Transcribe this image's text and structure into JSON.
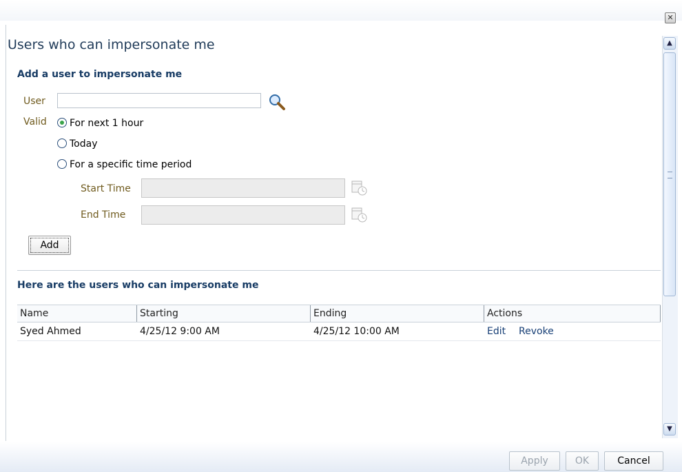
{
  "dialog": {
    "close_glyph": "✕"
  },
  "page_title": "Users who can impersonate me",
  "add_section": {
    "title": "Add a user to impersonate me",
    "user_label": "User",
    "user_value": "",
    "valid_label": "Valid",
    "options": [
      {
        "label": "For next 1 hour",
        "selected": true
      },
      {
        "label": "Today",
        "selected": false
      },
      {
        "label": "For a specific time period",
        "selected": false
      }
    ],
    "start_time_label": "Start Time",
    "start_time_value": "",
    "end_time_label": "End Time",
    "end_time_value": "",
    "add_button": "Add"
  },
  "list_section": {
    "title": "Here are the users who can impersonate me",
    "columns": [
      "Name",
      "Starting",
      "Ending",
      "Actions"
    ],
    "rows": [
      {
        "name": "Syed Ahmed",
        "starting": "4/25/12 9:00 AM",
        "ending": "4/25/12 10:00 AM",
        "actions": [
          "Edit",
          "Revoke"
        ]
      }
    ]
  },
  "footer": {
    "apply_label": "Apply",
    "ok_label": "OK",
    "cancel_label": "Cancel"
  },
  "icons": {
    "search": "search-icon",
    "calendar": "calendar-clock-icon",
    "close": "close-icon"
  },
  "colors": {
    "title": "#1f3a58",
    "section": "#173b64",
    "label": "#6f5a1d",
    "link": "#173f76",
    "radio_selected": "#3aa34a"
  }
}
